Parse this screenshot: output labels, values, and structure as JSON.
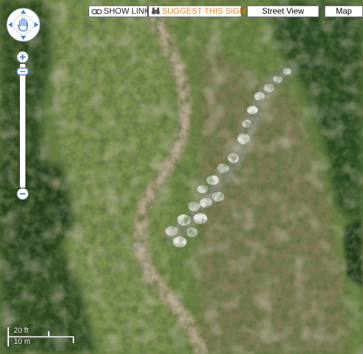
{
  "toolbar": {
    "show_link_label": "SHOW LINK",
    "suggest_label": "SUGGEST THIS SIGHT",
    "street_view_label": "Street View",
    "map_label": "Map"
  },
  "scale": {
    "feet_label": "20 ft",
    "meters_label": "10 m"
  },
  "colors": {
    "suggest_text": "#e8822a",
    "control_blue": "#4b82c9"
  },
  "icons": {
    "show_link": "chain-link-icon",
    "suggest": "binoculars-icon",
    "pan": "hand-icon",
    "zoom_in": "plus-icon",
    "zoom_out": "minus-icon"
  }
}
